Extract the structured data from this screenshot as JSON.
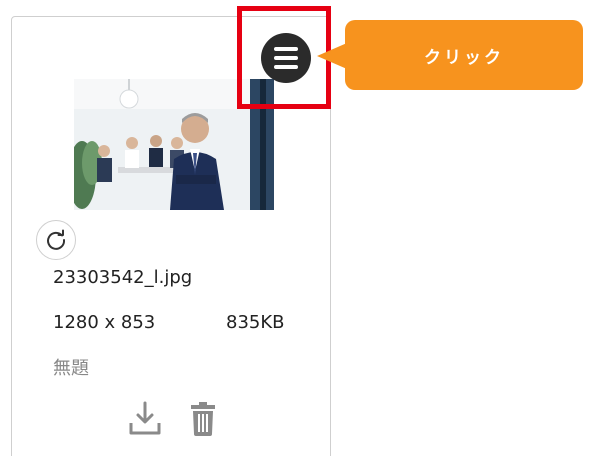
{
  "callout": {
    "text": "クリック"
  },
  "card": {
    "filename": "23303542_l.jpg",
    "dimensions": "1280 x 853",
    "filesize": "835KB",
    "title": "無題"
  },
  "icons": {
    "menu": "menu-icon",
    "refresh": "refresh-icon",
    "download": "download-icon",
    "delete": "trash-icon"
  },
  "colors": {
    "highlight": "#e60012",
    "callout": "#f7931e",
    "menu_button": "#2b2b2b",
    "icon_gray": "#8a8a8a"
  }
}
